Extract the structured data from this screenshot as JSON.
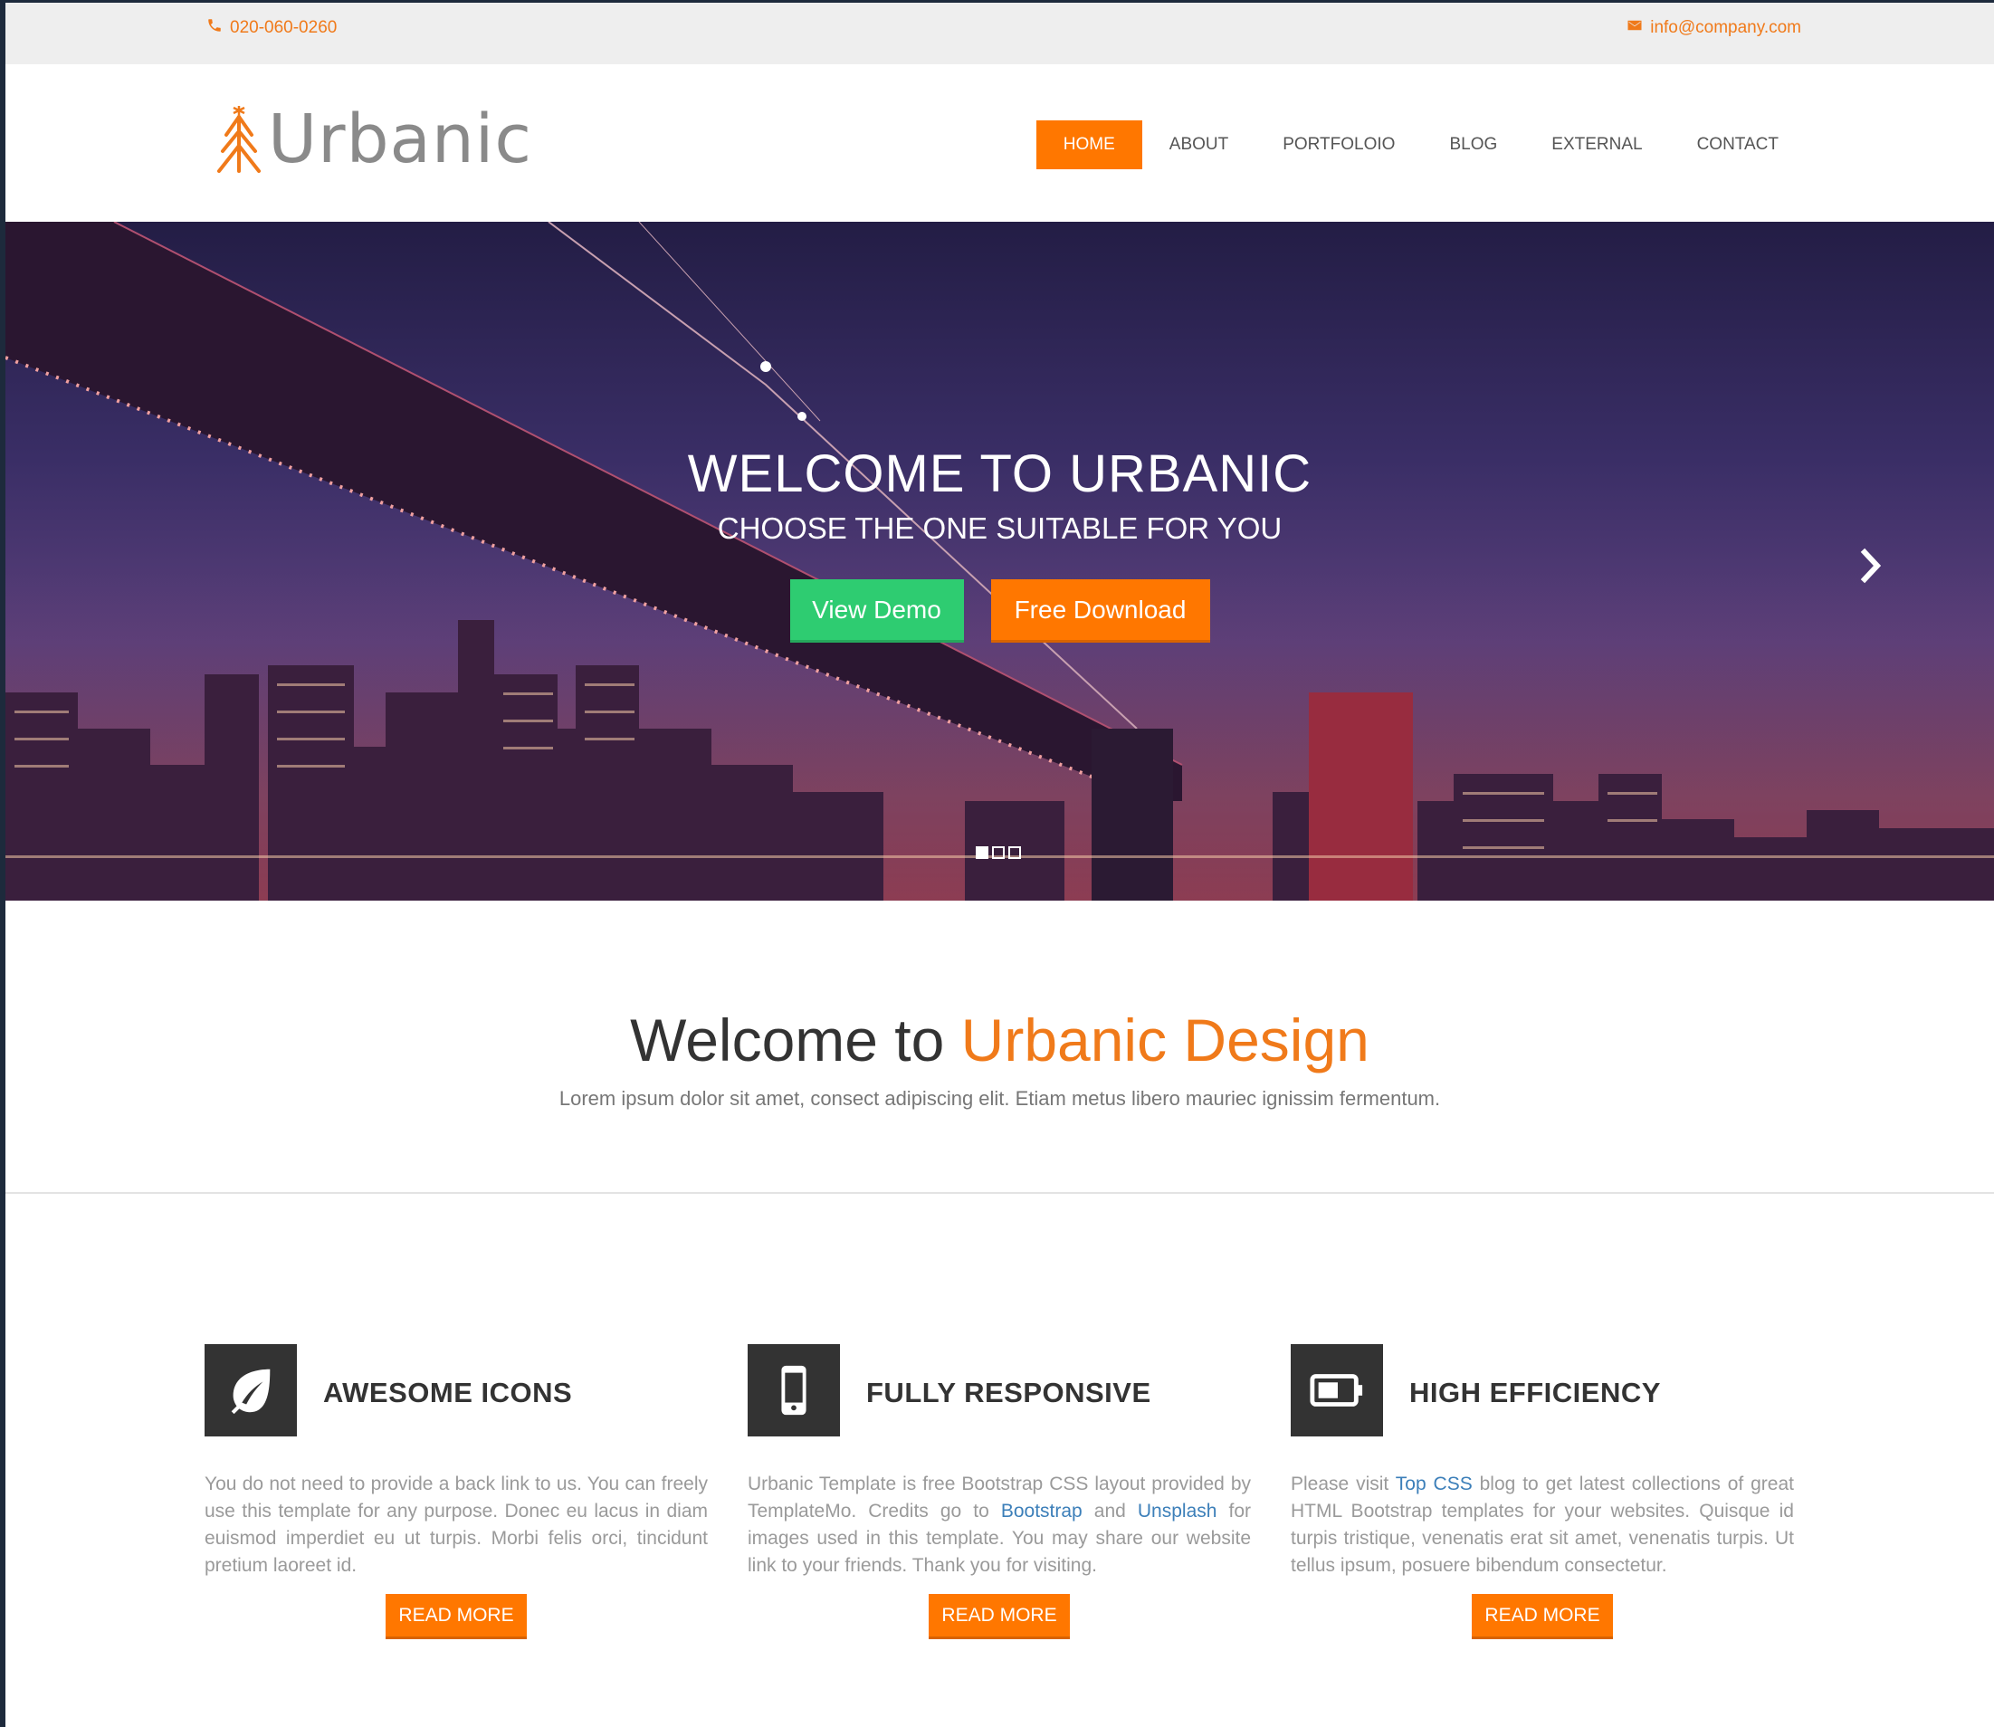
{
  "topbar": {
    "phone": "020-060-0260",
    "email": "info@company.com"
  },
  "brand": {
    "name": "Urbanic"
  },
  "nav": {
    "items": [
      {
        "label": "HOME"
      },
      {
        "label": "ABOUT"
      },
      {
        "label": "PORTFOLOIO"
      },
      {
        "label": "BLOG"
      },
      {
        "label": "EXTERNAL"
      },
      {
        "label": "CONTACT"
      }
    ]
  },
  "hero": {
    "title": "WELCOME TO URBANIC",
    "subtitle": "CHOOSE THE ONE SUITABLE FOR YOU",
    "demo_label": "View Demo",
    "download_label": "Free Download"
  },
  "welcome": {
    "title_start": "Welcome to ",
    "title_highlight": "Urbanic Design",
    "subtitle": "Lorem ipsum dolor sit amet, consect adipiscing elit. Etiam metus libero mauriec ignissim fermentum."
  },
  "features": [
    {
      "title": "AWESOME ICONS",
      "text": "You do not need to provide a back link to us. You can freely use this template for any purpose. Donec eu lacus in diam euismod imperdiet eu ut turpis. Morbi felis orci, tincidunt pretium laoreet id.",
      "button": "READ MORE"
    },
    {
      "title": "FULLY RESPONSIVE",
      "text_a": "Urbanic Template is free Bootstrap CSS layout provided by TemplateMo. Credits go to ",
      "link_a": "Bootstrap",
      "text_b": " and ",
      "link_b": "Unsplash",
      "text_c": " for images used in this template. You may share our website link to your friends. Thank you for visiting.",
      "button": "READ MORE"
    },
    {
      "title": "HIGH EFFICIENCY",
      "text_a": "Please visit ",
      "link_a": "Top CSS",
      "text_b": " blog to get latest collections of great HTML Bootstrap templates for your websites. Quisque id turpis tristique, venenatis erat sit amet, venenatis turpis. Ut tellus ipsum, posuere bibendum consectetur.",
      "button": "READ MORE"
    }
  ],
  "icons": {
    "phone": "phone-icon",
    "email": "envelope-icon",
    "next": "chevron-right-icon",
    "feature1": "leaf-icon",
    "feature2": "mobile-phone-icon",
    "feature3": "battery-icon"
  },
  "colors": {
    "accent": "#ff7700",
    "green": "#2ecc71",
    "link": "#3c7fb9",
    "dark": "#333333"
  }
}
